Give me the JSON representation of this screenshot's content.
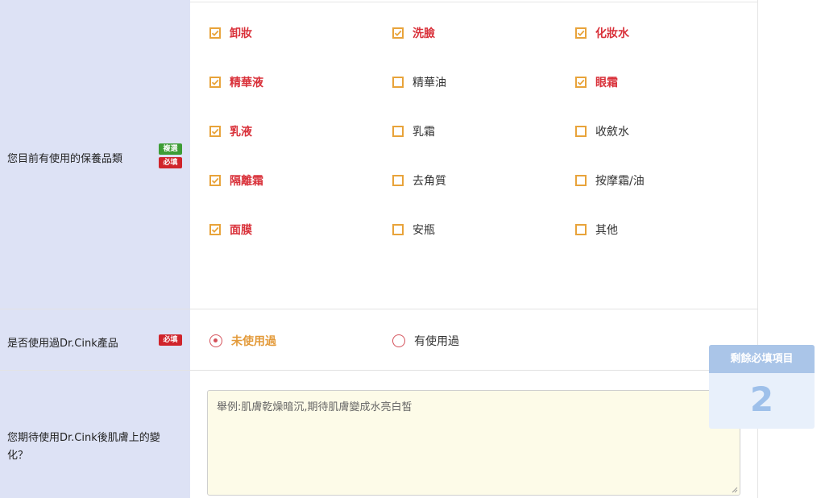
{
  "q1": {
    "label": "您目前有使用的保養品類",
    "badge_multi": "複選",
    "badge_required": "必填",
    "options": [
      {
        "label": "卸妝",
        "checked": true
      },
      {
        "label": "洗臉",
        "checked": true
      },
      {
        "label": "化妝水",
        "checked": true
      },
      {
        "label": "精華液",
        "checked": true
      },
      {
        "label": "精華油",
        "checked": false
      },
      {
        "label": "眼霜",
        "checked": true
      },
      {
        "label": "乳液",
        "checked": true
      },
      {
        "label": "乳霜",
        "checked": false
      },
      {
        "label": "收斂水",
        "checked": false
      },
      {
        "label": "隔離霜",
        "checked": true
      },
      {
        "label": "去角質",
        "checked": false
      },
      {
        "label": "按摩霜/油",
        "checked": false
      },
      {
        "label": "面膜",
        "checked": true
      },
      {
        "label": "安瓶",
        "checked": false
      },
      {
        "label": "其他",
        "checked": false
      }
    ]
  },
  "q2": {
    "label": "是否使用過Dr.Cink產品",
    "badge_required": "必填",
    "options": [
      {
        "label": "未使用過",
        "selected": true
      },
      {
        "label": "有使用過",
        "selected": false
      }
    ]
  },
  "q3": {
    "label": "您期待使用Dr.Cink後肌膚上的變化？",
    "label_line1": "您期待使用Dr.Cink後肌膚上的變",
    "label_line2": "化？",
    "placeholder": "舉例:肌膚乾燥暗沉,期待肌膚變成水亮白皙"
  },
  "remaining": {
    "title": "剩餘必填項目",
    "count": "2"
  },
  "colors": {
    "label_bg": "#dde2f5",
    "checkbox_border": "#e8a33a",
    "checked_text": "#d9313a",
    "radio_selected_text": "#e39a3a",
    "textarea_bg": "#fdfbe8"
  }
}
